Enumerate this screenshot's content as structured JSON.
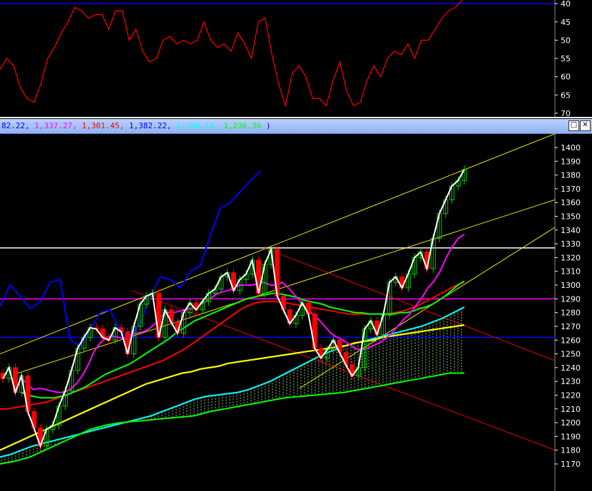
{
  "panel_top": {
    "y_ticks": [
      "70",
      "65",
      "60",
      "55",
      "50",
      "45",
      "40"
    ],
    "upper_band_level": 70
  },
  "titlebar": {
    "legend": [
      {
        "text": "82.22,",
        "color": "#0000ff"
      },
      {
        "text": "1,337.27,",
        "color": "#ff00ff"
      },
      {
        "text": "1,301.45,",
        "color": "#ff0000"
      },
      {
        "text": "1,382.22,",
        "color": "#0000ff"
      },
      {
        "text": "1,284.13,",
        "color": "#00ffff"
      },
      {
        "text": "1,236.36",
        "color": "#00ff00"
      },
      {
        "text": ")",
        "color": "#0000ff"
      }
    ],
    "restore_label": "□",
    "close_label": "✕"
  },
  "colors": {
    "background": "#000000",
    "axis_text": "#ffffff",
    "rsi": "#ff0000",
    "price": "#ffffff",
    "up_candle": "#00cc00",
    "down_candle": "#ff0000",
    "ma_short": "#ff00ff",
    "ma_mid": "#00ff00",
    "ma_long": "#ff0000",
    "ma_longest": "#ffff00",
    "span_a": "#00ffff",
    "span_b": "#00ff00",
    "lagging": "#0000ff",
    "channel": "#ffff00",
    "down_channel": "#ff0000",
    "hline_white": "#ffffff",
    "hline_magenta": "#ff00ff",
    "hline_blue": "#0000ff"
  },
  "chart_data": [
    {
      "type": "line",
      "panel": "rsi",
      "ylim": [
        39,
        71
      ],
      "y_ticks": [
        40,
        45,
        50,
        55,
        60,
        65,
        70
      ],
      "series": [
        {
          "values": [
            52,
            55,
            53,
            47,
            44,
            43,
            48,
            55,
            58,
            62,
            65,
            69,
            68,
            66,
            67,
            67,
            63,
            68,
            68,
            60,
            63,
            57,
            54,
            55,
            60,
            61,
            59,
            60,
            59,
            60,
            65,
            60,
            58,
            59,
            57,
            62,
            59,
            55,
            65,
            66,
            56,
            48,
            42,
            51,
            53,
            50,
            44,
            44,
            42,
            49,
            54,
            46,
            42,
            43,
            49,
            53,
            50,
            55,
            57,
            56,
            59,
            55,
            60,
            60,
            63,
            66,
            68,
            69,
            71
          ]
        }
      ]
    },
    {
      "type": "candlestick",
      "panel": "price",
      "ylim": [
        1160,
        1410
      ],
      "y_ticks": [
        1170,
        1180,
        1190,
        1200,
        1210,
        1220,
        1230,
        1240,
        1250,
        1260,
        1270,
        1280,
        1290,
        1300,
        1310,
        1320,
        1330,
        1340,
        1350,
        1360,
        1370,
        1380,
        1390,
        1400
      ],
      "horizontal_lines": [
        1327,
        1290,
        1262
      ],
      "close": [
        1232,
        1240,
        1222,
        1234,
        1208,
        1196,
        1183,
        1195,
        1198,
        1212,
        1223,
        1238,
        1254,
        1262,
        1269,
        1268,
        1262,
        1260,
        1269,
        1266,
        1250,
        1270,
        1286,
        1292,
        1294,
        1262,
        1282,
        1273,
        1265,
        1280,
        1287,
        1282,
        1288,
        1294,
        1297,
        1306,
        1309,
        1296,
        1304,
        1308,
        1318,
        1294,
        1315,
        1326,
        1292,
        1282,
        1272,
        1278,
        1287,
        1279,
        1254,
        1247,
        1253,
        1260,
        1251,
        1242,
        1234,
        1240,
        1268,
        1274,
        1264,
        1278,
        1302,
        1306,
        1298,
        1308,
        1320,
        1324,
        1312,
        1334,
        1352,
        1362,
        1372,
        1376,
        1384
      ],
      "ma_short": [
        1232,
        1228,
        1224,
        1225,
        1224,
        1223,
        1222,
        1222,
        1224,
        1228,
        1234,
        1242,
        1252,
        1258,
        1262,
        1263,
        1262,
        1261,
        1264,
        1265,
        1266,
        1268,
        1272,
        1277,
        1280,
        1280,
        1281,
        1282,
        1283,
        1285,
        1287,
        1290,
        1293,
        1295,
        1296,
        1298,
        1300,
        1300,
        1300,
        1301,
        1302,
        1300,
        1300,
        1302,
        1298,
        1293,
        1288,
        1283,
        1279,
        1275,
        1270,
        1265,
        1262,
        1260,
        1257,
        1254,
        1253,
        1254,
        1256,
        1258,
        1261,
        1265,
        1270,
        1275,
        1279,
        1285,
        1291,
        1298,
        1303,
        1310,
        1320,
        1328,
        1334,
        1337
      ],
      "ma_mid": [
        1222,
        1220,
        1219,
        1218,
        1218,
        1218,
        1219,
        1220,
        1222,
        1224,
        1226,
        1229,
        1232,
        1235,
        1237,
        1239,
        1241,
        1243,
        1246,
        1249,
        1252,
        1255,
        1258,
        1261,
        1265,
        1268,
        1271,
        1274,
        1276,
        1278,
        1280,
        1282,
        1284,
        1286,
        1288,
        1290,
        1291,
        1292,
        1293,
        1294,
        1294,
        1293,
        1292,
        1291,
        1289,
        1288,
        1287,
        1286,
        1284,
        1283,
        1282,
        1281,
        1280,
        1280,
        1279,
        1279,
        1279,
        1279,
        1279,
        1280,
        1280,
        1281,
        1283,
        1284,
        1286,
        1289,
        1292,
        1296,
        1300,
        1303
      ],
      "ma_long": [
        1210,
        1210,
        1211,
        1212,
        1213,
        1214,
        1215,
        1217,
        1219,
        1221,
        1223,
        1225,
        1227,
        1229,
        1231,
        1233,
        1235,
        1237,
        1239,
        1241,
        1243,
        1245,
        1248,
        1251,
        1254,
        1258,
        1262,
        1266,
        1270,
        1274,
        1278,
        1282,
        1285,
        1287,
        1288,
        1288,
        1288,
        1287,
        1286,
        1285,
        1284,
        1283,
        1282,
        1281,
        1280,
        1279,
        1279,
        1279,
        1279,
        1279,
        1279,
        1280,
        1281,
        1283,
        1285,
        1288,
        1291,
        1294,
        1297,
        1300,
        1302
      ],
      "ma_longest": [
        1180,
        1183,
        1186,
        1189,
        1192,
        1195,
        1198,
        1201,
        1204,
        1207,
        1210,
        1213,
        1216,
        1219,
        1222,
        1225,
        1228,
        1230,
        1232,
        1234,
        1236,
        1237,
        1239,
        1240,
        1241,
        1243,
        1244,
        1245,
        1246,
        1247,
        1248,
        1249,
        1250,
        1251,
        1252,
        1253,
        1254,
        1255,
        1256,
        1258,
        1259,
        1260,
        1262,
        1263,
        1264,
        1265,
        1266,
        1267,
        1268,
        1269,
        1270,
        1271
      ],
      "span_a": [
        1175,
        1177,
        1180,
        1183,
        1185,
        1187,
        1189,
        1191,
        1193,
        1195,
        1197,
        1199,
        1201,
        1203,
        1205,
        1208,
        1211,
        1214,
        1217,
        1219,
        1220,
        1221,
        1222,
        1224,
        1227,
        1230,
        1234,
        1238,
        1242,
        1246,
        1250,
        1253,
        1256,
        1258,
        1260,
        1262,
        1264,
        1266,
        1268,
        1270,
        1273,
        1276,
        1280,
        1284
      ],
      "span_b": [
        1170,
        1172,
        1175,
        1180,
        1185,
        1190,
        1195,
        1198,
        1200,
        1201,
        1202,
        1203,
        1204,
        1205,
        1208,
        1210,
        1212,
        1214,
        1216,
        1218,
        1219,
        1220,
        1221,
        1222,
        1224,
        1226,
        1228,
        1230,
        1232,
        1234,
        1236,
        1236
      ],
      "lagging": [
        1285,
        1300,
        1292,
        1283,
        1288,
        1302,
        1304,
        1260,
        1256,
        1268,
        1280,
        1282,
        1266,
        1262,
        1272,
        1292,
        1306,
        1304,
        1298,
        1310,
        1314,
        1336,
        1356,
        1360,
        1368,
        1376,
        1383
      ]
    }
  ]
}
